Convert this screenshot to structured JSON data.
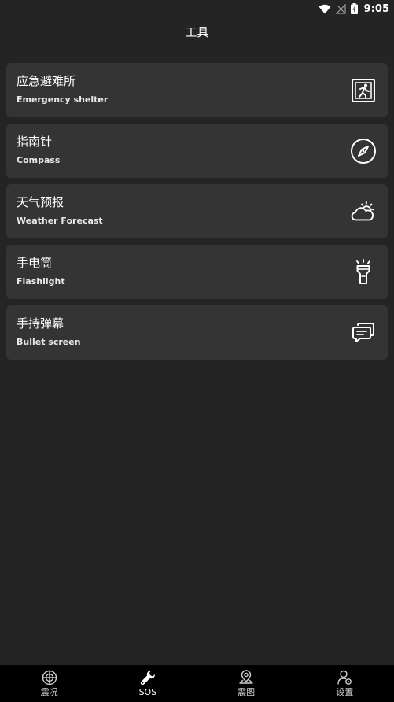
{
  "status_bar": {
    "time": "9:05"
  },
  "header": {
    "title": "工具"
  },
  "tools": [
    {
      "title": "应急避难所",
      "subtitle": "Emergency shelter",
      "icon": "emergency-exit-icon"
    },
    {
      "title": "指南针",
      "subtitle": "Compass",
      "icon": "compass-icon"
    },
    {
      "title": "天气预报",
      "subtitle": "Weather Forecast",
      "icon": "weather-icon"
    },
    {
      "title": "手电筒",
      "subtitle": "Flashlight",
      "icon": "flashlight-icon"
    },
    {
      "title": "手持弹幕",
      "subtitle": "Bullet screen",
      "icon": "chat-bubble-icon"
    }
  ],
  "nav": [
    {
      "label": "震况",
      "icon": "target-icon",
      "active": false
    },
    {
      "label": "SOS",
      "icon": "wrench-icon",
      "active": true
    },
    {
      "label": "震图",
      "icon": "map-pin-icon",
      "active": false
    },
    {
      "label": "设置",
      "icon": "user-settings-icon",
      "active": false
    }
  ],
  "colors": {
    "background": "#242424",
    "card": "#353434",
    "nav_bar": "#000000",
    "text": "#ffffff"
  }
}
